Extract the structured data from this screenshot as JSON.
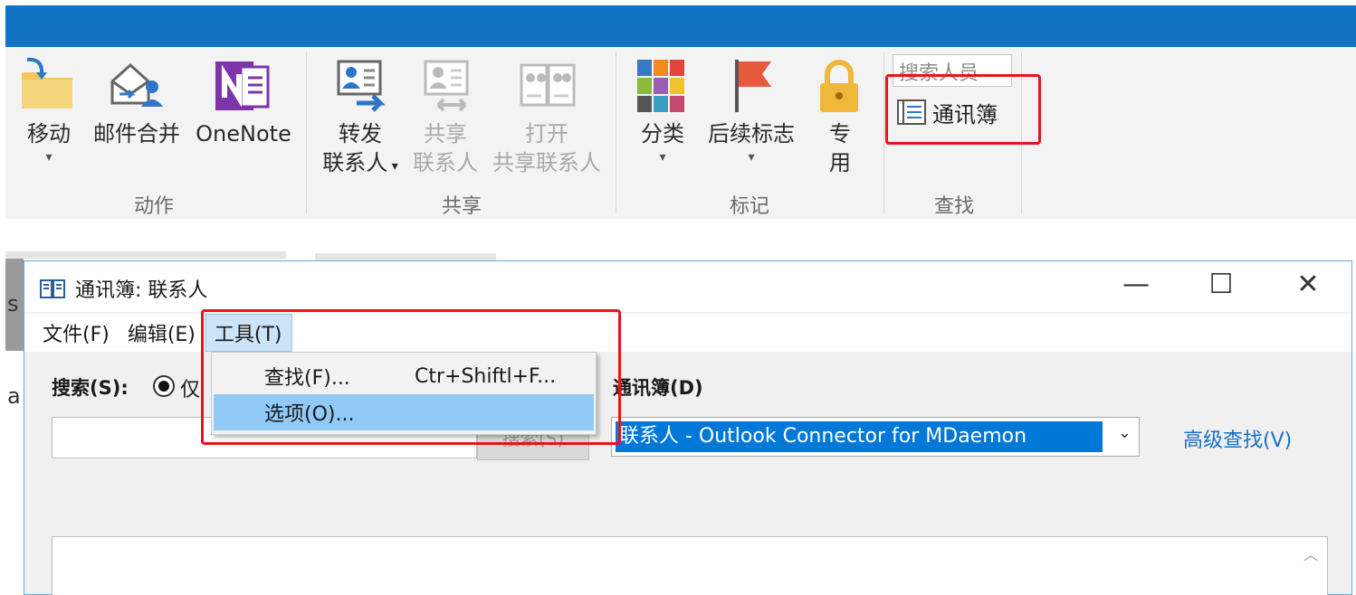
{
  "ribbon": {
    "actions": {
      "move": "移动",
      "mail_merge": "邮件合并",
      "onenote": "OneNote",
      "group_label": "动作"
    },
    "share": {
      "forward_contact_line1": "转发",
      "forward_contact_line2": "联系人",
      "share_contact_line1": "共享",
      "share_contact_line2": "联系人",
      "open_shared_line1": "打开",
      "open_shared_line2": "共享联系人",
      "group_label": "共享"
    },
    "tags": {
      "categorize": "分类",
      "follow_up": "后续标志",
      "private_line1": "专",
      "private_line2": "用",
      "group_label": "标记"
    },
    "find": {
      "search_people_placeholder": "搜索人员",
      "address_book": "通讯簿",
      "group_label": "查找"
    }
  },
  "background": {
    "left_char_1": "s",
    "left_char_2": "a"
  },
  "dialog": {
    "title": "通讯簿: 联系人",
    "controls": {
      "minimize": "—",
      "maximize": "☐",
      "close": "✕"
    },
    "menu": {
      "file": "文件(F)",
      "edit": "编辑(E)",
      "tools": "工具(T)"
    },
    "tools_menu": {
      "find": "查找(F)...",
      "find_shortcut": "Ctr+Shiftl+F...",
      "options": "选项(O)..."
    },
    "search_label": "搜索(S):",
    "radio_label": "仅",
    "search_input_value": "",
    "go_button": "搜索(S)",
    "address_book_label": "通讯簿(D)",
    "address_book_selected": "联系人 - Outlook Connector for MDaemon",
    "advanced_find": "高级查找(V)"
  },
  "colors": {
    "titlebar": "#1272c4",
    "highlight": "#91c9f7",
    "selection": "#0078d7",
    "annotation_red": "#e8141c",
    "link": "#1a6fc5"
  }
}
